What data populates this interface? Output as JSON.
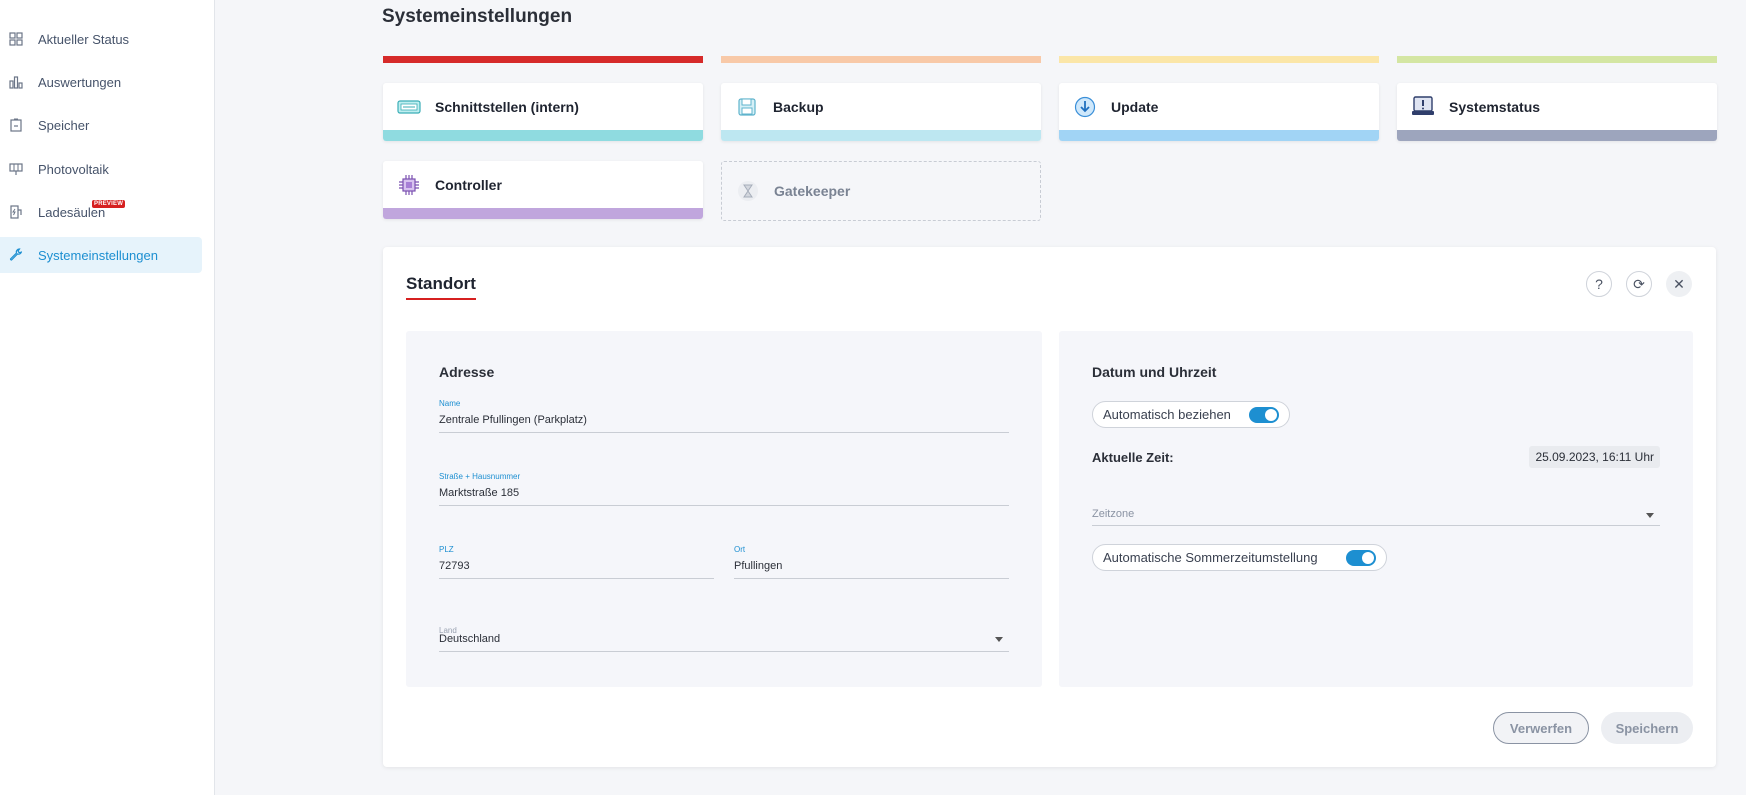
{
  "sidebar": {
    "items": [
      {
        "label": "Aktueller Status",
        "icon": "dashboard-grid-icon"
      },
      {
        "label": "Auswertungen",
        "icon": "bar-chart-icon"
      },
      {
        "label": "Speicher",
        "icon": "battery-storage-icon"
      },
      {
        "label": "Photovoltaik",
        "icon": "solar-panel-icon"
      },
      {
        "label": "Ladesäulen",
        "icon": "charging-station-icon",
        "badge": "PREVIEW"
      },
      {
        "label": "Systemeinstellungen",
        "icon": "wrench-icon",
        "active": true
      }
    ]
  },
  "page": {
    "title": "Systemeinstellungen"
  },
  "strip_colors": [
    "#d62a2a",
    "#f8c9a8",
    "#fbe6a8",
    "#d4e6a3"
  ],
  "tiles": [
    {
      "label": "Schnittstellen (intern)",
      "icon": "interface-icon",
      "color": "#8fdbe0"
    },
    {
      "label": "Backup",
      "icon": "floppy-disk-icon",
      "color": "#bde7f1"
    },
    {
      "label": "Update",
      "icon": "download-circle-icon",
      "color": "#a1d4f5"
    },
    {
      "label": "Systemstatus",
      "icon": "monitor-alert-icon",
      "color": "#9da5bd"
    },
    {
      "label": "Controller",
      "icon": "cpu-chip-icon",
      "color": "#c0a6dd"
    },
    {
      "label": "Gatekeeper",
      "icon": "hourglass-icon",
      "disabled": true
    }
  ],
  "card": {
    "title": "Standort",
    "actions": {
      "help": "?",
      "refresh": "⟳",
      "close": "✕"
    },
    "address": {
      "heading": "Adresse",
      "name_label": "Name",
      "name_value": "Zentrale Pfullingen (Parkplatz)",
      "street_label": "Straße + Hausnummer",
      "street_value": "Marktstraße 185",
      "zip_label": "PLZ",
      "zip_value": "72793",
      "city_label": "Ort",
      "city_value": "Pfullingen",
      "country_label": "Land",
      "country_value": "Deutschland"
    },
    "datetime": {
      "heading": "Datum und Uhrzeit",
      "auto_label": "Automatisch beziehen",
      "current_time_label": "Aktuelle Zeit:",
      "current_time_value": "25.09.2023, 16:11 Uhr",
      "timezone_placeholder": "Zeitzone",
      "dst_label": "Automatische Sommerzeitumstellung"
    },
    "buttons": {
      "discard": "Verwerfen",
      "save": "Speichern"
    }
  }
}
